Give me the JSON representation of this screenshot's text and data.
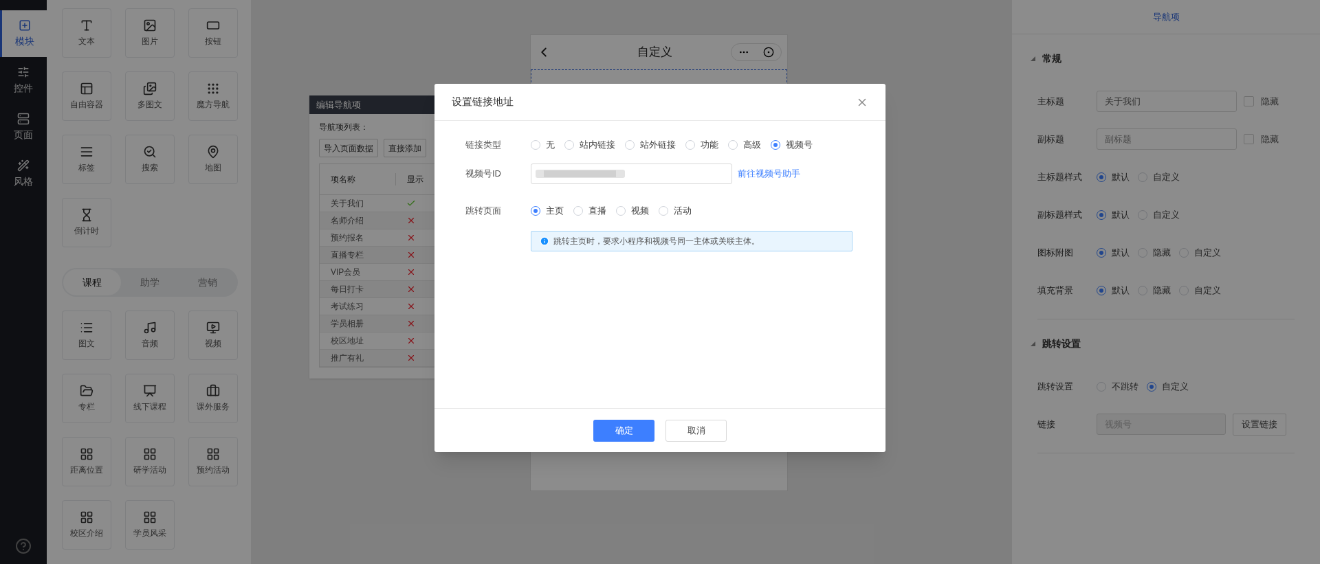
{
  "nav": [
    {
      "label": "模块",
      "selected": true
    },
    {
      "label": "控件",
      "selected": false
    },
    {
      "label": "页面",
      "selected": false
    },
    {
      "label": "风格",
      "selected": false
    }
  ],
  "widgets_basic": [
    "文本",
    "图片",
    "按钮",
    "自由容器",
    "多图文",
    "魔方导航",
    "标签",
    "搜索",
    "地图",
    "倒计时"
  ],
  "category_tabs": [
    {
      "label": "课程",
      "selected": true
    },
    {
      "label": "助学",
      "selected": false
    },
    {
      "label": "营销",
      "selected": false
    }
  ],
  "widgets_course": [
    "图文",
    "音频",
    "视频",
    "专栏",
    "线下课程",
    "课外服务",
    "距离位置",
    "研学活动",
    "预约活动",
    "校区介绍",
    "学员风采"
  ],
  "phone": {
    "title": "自定义"
  },
  "nav_editor": {
    "title": "编辑导航项",
    "list_label": "导航项列表：",
    "buttons": [
      "导入页面数据",
      "直接添加"
    ],
    "columns": [
      "项名称",
      "显示"
    ],
    "rows": [
      {
        "name": "关于我们",
        "shown": true
      },
      {
        "name": "名师介绍",
        "shown": false
      },
      {
        "name": "预约报名",
        "shown": false
      },
      {
        "name": "直播专栏",
        "shown": false
      },
      {
        "name": "VIP会员",
        "shown": false
      },
      {
        "name": "每日打卡",
        "shown": false
      },
      {
        "name": "考试练习",
        "shown": false
      },
      {
        "name": "学员相册",
        "shown": false
      },
      {
        "name": "校区地址",
        "shown": false
      },
      {
        "name": "推广有礼",
        "shown": false
      }
    ]
  },
  "modal": {
    "title": "设置链接地址",
    "link_type": {
      "label": "链接类型",
      "options": [
        {
          "label": "无",
          "selected": false
        },
        {
          "label": "站内链接",
          "selected": false
        },
        {
          "label": "站外链接",
          "selected": false
        },
        {
          "label": "功能",
          "selected": false
        },
        {
          "label": "高级",
          "selected": false
        },
        {
          "label": "视频号",
          "selected": true
        }
      ]
    },
    "channel_id": {
      "label": "视频号ID",
      "link": "前往视频号助手"
    },
    "target_page": {
      "label": "跳转页面",
      "options": [
        {
          "label": "主页",
          "selected": true
        },
        {
          "label": "直播",
          "selected": false
        },
        {
          "label": "视频",
          "selected": false
        },
        {
          "label": "活动",
          "selected": false
        }
      ]
    },
    "notice": "跳转主页时，要求小程序和视频号同一主体或关联主体。",
    "confirm": "确定",
    "cancel": "取消"
  },
  "right_panel": {
    "tab": "导航项",
    "sections": [
      {
        "title": "常规",
        "expanded": true,
        "rows": [
          {
            "kind": "text",
            "label": "主标题",
            "value": "关于我们",
            "hide_label": "隐藏",
            "hidden": false
          },
          {
            "kind": "text",
            "label": "副标题",
            "placeholder": "副标题",
            "hide_label": "隐藏",
            "hidden": false
          },
          {
            "kind": "radio",
            "label": "主标题样式",
            "options": [
              {
                "label": "默认",
                "selected": true
              },
              {
                "label": "自定义",
                "selected": false
              }
            ]
          },
          {
            "kind": "radio",
            "label": "副标题样式",
            "options": [
              {
                "label": "默认",
                "selected": true
              },
              {
                "label": "自定义",
                "selected": false
              }
            ]
          },
          {
            "kind": "radio",
            "label": "图标附图",
            "options": [
              {
                "label": "默认",
                "selected": true
              },
              {
                "label": "隐藏",
                "selected": false
              },
              {
                "label": "自定义",
                "selected": false
              }
            ]
          },
          {
            "kind": "radio",
            "label": "填充背景",
            "options": [
              {
                "label": "默认",
                "selected": true
              },
              {
                "label": "隐藏",
                "selected": false
              },
              {
                "label": "自定义",
                "selected": false
              }
            ]
          }
        ]
      },
      {
        "title": "跳转设置",
        "expanded": true,
        "rows": [
          {
            "kind": "radio",
            "label": "跳转设置",
            "options": [
              {
                "label": "不跳转",
                "selected": false
              },
              {
                "label": "自定义",
                "selected": true
              }
            ]
          },
          {
            "kind": "link",
            "label": "链接",
            "value": "视频号",
            "disabled": true,
            "button": "设置链接"
          }
        ]
      }
    ]
  }
}
